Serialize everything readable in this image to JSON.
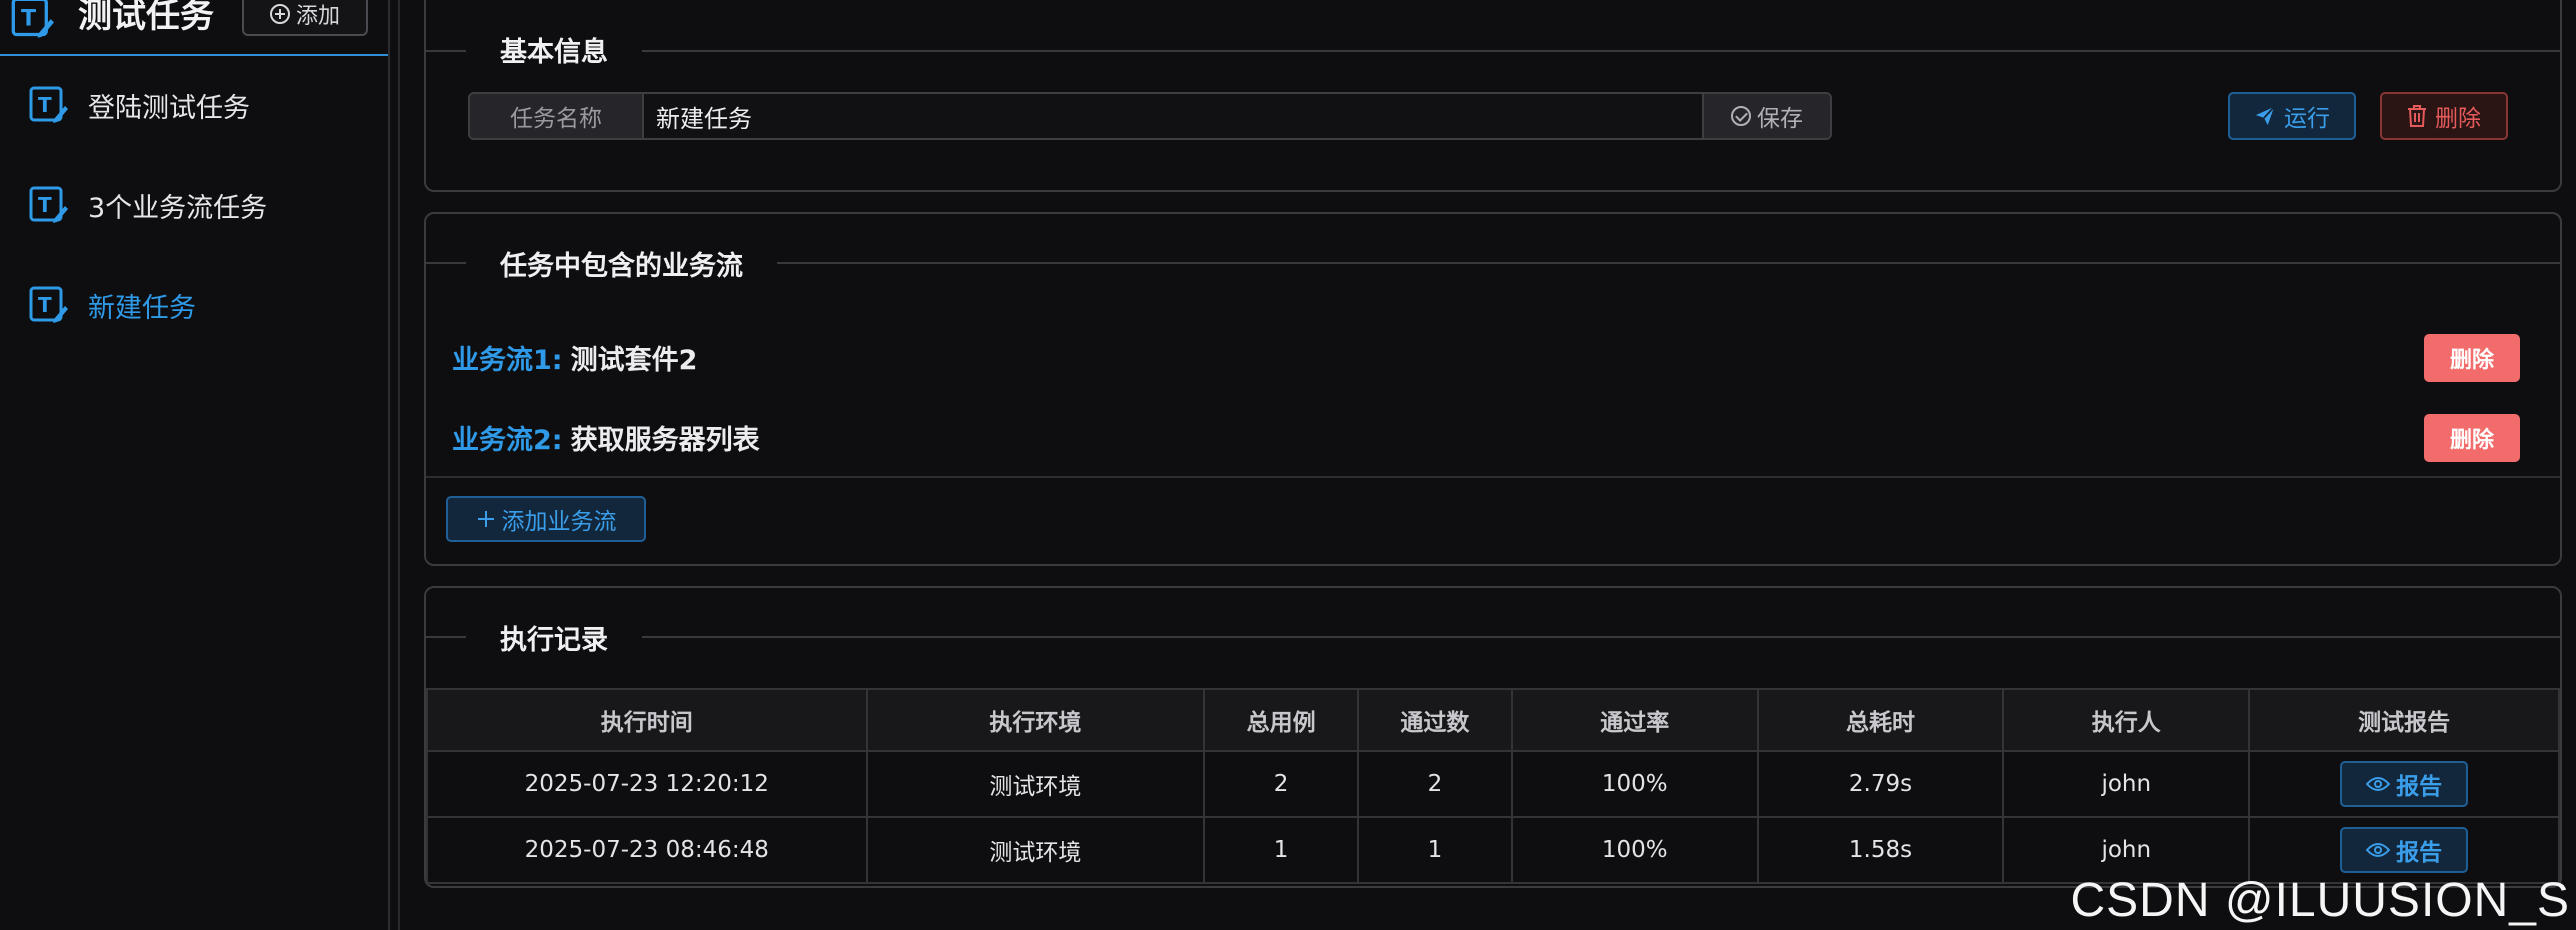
{
  "sidebar": {
    "title": "测试任务",
    "add_label": "添加",
    "items": [
      {
        "label": "登陆测试任务",
        "active": false
      },
      {
        "label": "3个业务流任务",
        "active": false
      },
      {
        "label": "新建任务",
        "active": true
      }
    ]
  },
  "basic_info": {
    "legend": "基本信息",
    "name_label": "任务名称",
    "name_value": "新建任务",
    "save_label": "保存",
    "run_label": "运行",
    "delete_label": "删除"
  },
  "flows": {
    "legend": "任务中包含的业务流",
    "items": [
      {
        "key": "业务流1:",
        "name": "测试套件2",
        "delete_label": "删除"
      },
      {
        "key": "业务流2:",
        "name": "获取服务器列表",
        "delete_label": "删除"
      }
    ],
    "add_label": "添加业务流"
  },
  "records": {
    "legend": "执行记录",
    "columns": [
      "执行时间",
      "执行环境",
      "总用例",
      "通过数",
      "通过率",
      "总耗时",
      "执行人",
      "测试报告"
    ],
    "rows": [
      {
        "time": "2025-07-23 12:20:12",
        "env": "测试环境",
        "total": "2",
        "passed": "2",
        "rate": "100%",
        "duration": "2.79s",
        "user": "john",
        "report": "报告"
      },
      {
        "time": "2025-07-23 08:46:48",
        "env": "测试环境",
        "total": "1",
        "passed": "1",
        "rate": "100%",
        "duration": "1.58s",
        "user": "john",
        "report": "报告"
      }
    ]
  },
  "watermark": "CSDN @ILUUSION_S",
  "colors": {
    "accent": "#2f9ae8",
    "danger": "#f36c6c",
    "background": "#0e0e10"
  },
  "icons": [
    "task-edit-icon",
    "plus-circle-icon",
    "check-circle-icon",
    "send-icon",
    "trash-icon",
    "plus-icon",
    "eye-icon"
  ]
}
